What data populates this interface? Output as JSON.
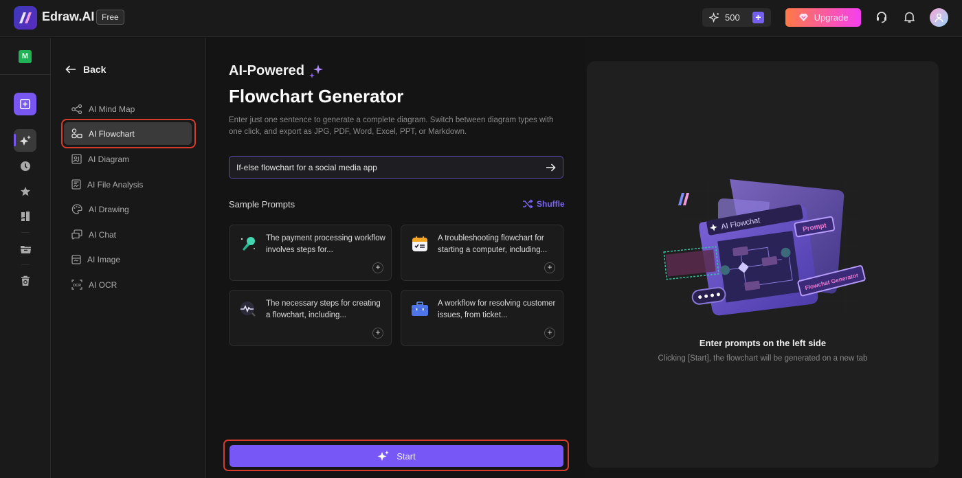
{
  "app": {
    "brand": "Edraw.AI",
    "plan_badge": "Free",
    "credits": "500",
    "upgrade_label": "Upgrade",
    "workspace_initial": "M"
  },
  "colors": {
    "accent": "#7757f5",
    "highlight_ring": "#d63c2c",
    "workspace_badge": "#20b356",
    "upgrade_gradient_start": "#ff7a45",
    "upgrade_gradient_end": "#f43ff0"
  },
  "rail": {
    "icons": [
      "new-file-icon",
      "ai-sparkle-icon",
      "recent-clock-icon",
      "star-icon",
      "templates-icon",
      "folder-icon",
      "trash-icon"
    ]
  },
  "sidenav": {
    "back_label": "Back",
    "items": [
      {
        "label": "AI Mind Map",
        "icon": "mind-map-icon",
        "active": false
      },
      {
        "label": "AI Flowchart",
        "icon": "flowchart-icon",
        "active": true
      },
      {
        "label": "AI Diagram",
        "icon": "diagram-icon",
        "active": false
      },
      {
        "label": "AI File Analysis",
        "icon": "file-analysis-icon",
        "active": false
      },
      {
        "label": "AI Drawing",
        "icon": "palette-icon",
        "active": false
      },
      {
        "label": "AI Chat",
        "icon": "chat-icon",
        "active": false
      },
      {
        "label": "AI Image",
        "icon": "image-icon",
        "active": false
      },
      {
        "label": "AI OCR",
        "icon": "ocr-icon",
        "active": false
      }
    ]
  },
  "main": {
    "kicker": "AI-Powered",
    "title": "Flowchart Generator",
    "description": "Enter just one sentence to generate a complete diagram. Switch between diagram types with one click, and export as JPG, PDF, Word, Excel, PPT, or Markdown.",
    "prompt_value": "If-else flowchart for a social media app",
    "sample_prompts_label": "Sample Prompts",
    "shuffle_label": "Shuffle",
    "samples": [
      {
        "text": "The payment processing workflow involves steps for...",
        "icon": "microphone-icon"
      },
      {
        "text": "A troubleshooting flowchart for starting a computer, including...",
        "icon": "checklist-calendar-icon"
      },
      {
        "text": "The necessary steps for creating a flowchart, including...",
        "icon": "pulse-search-icon"
      },
      {
        "text": "A workflow for resolving customer issues, from ticket...",
        "icon": "briefcase-icon"
      }
    ],
    "start_label": "Start"
  },
  "preview": {
    "title": "Enter prompts on the left side",
    "subtitle": "Clicking [Start], the flowchart will be generated on a new tab",
    "illustration": {
      "search_text": "AI Flowchat",
      "prompt_tag": "Prompt",
      "generator_tag": "Flowchat Generator"
    }
  }
}
